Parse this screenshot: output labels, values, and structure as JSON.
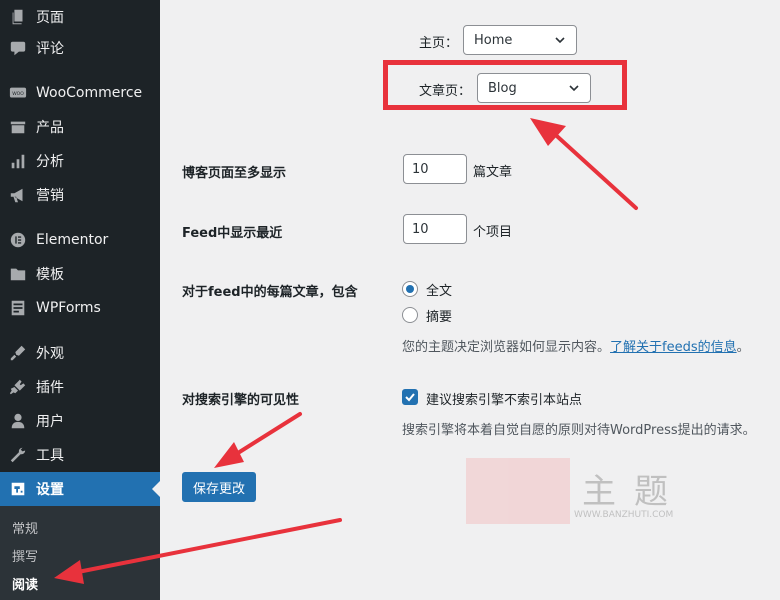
{
  "sidebar": {
    "items": [
      {
        "label": "页面",
        "icon": "pages-icon"
      },
      {
        "label": "评论",
        "icon": "comments-icon"
      },
      {
        "label": "WooCommerce",
        "icon": "woocommerce-icon"
      },
      {
        "label": "产品",
        "icon": "products-icon"
      },
      {
        "label": "分析",
        "icon": "analytics-icon"
      },
      {
        "label": "营销",
        "icon": "marketing-icon"
      },
      {
        "label": "Elementor",
        "icon": "elementor-icon"
      },
      {
        "label": "模板",
        "icon": "templates-icon"
      },
      {
        "label": "WPForms",
        "icon": "wpforms-icon"
      },
      {
        "label": "外观",
        "icon": "appearance-icon"
      },
      {
        "label": "插件",
        "icon": "plugins-icon"
      },
      {
        "label": "用户",
        "icon": "users-icon"
      },
      {
        "label": "工具",
        "icon": "tools-icon"
      },
      {
        "label": "设置",
        "icon": "settings-icon",
        "active": true
      }
    ],
    "submenu": [
      {
        "label": "常规"
      },
      {
        "label": "撰写"
      },
      {
        "label": "阅读",
        "current": true
      }
    ]
  },
  "reading": {
    "homepage_label": "主页：",
    "homepage_value": "Home",
    "posts_page_label": "文章页：",
    "posts_page_value": "Blog",
    "blog_pages_label": "博客页面至多显示",
    "blog_pages_value": "10",
    "blog_pages_unit": "篇文章",
    "feed_label": "Feed中显示最近",
    "feed_value": "10",
    "feed_unit": "个项目",
    "feed_content_label": "对于feed中的每篇文章，包含",
    "option_full": "全文",
    "option_excerpt": "摘要",
    "selected_option": "全文",
    "feed_desc_prefix": "您的主题决定浏览器如何显示内容。",
    "feed_desc_link": "了解关于feeds的信息",
    "feed_desc_suffix": "。",
    "search_visibility_label": "对搜索引擎的可见性",
    "search_checkbox_label": "建议搜索引擎不索引本站点",
    "search_checkbox_checked": true,
    "search_desc": "搜索引擎将本着自觉自愿的原则对待WordPress提出的请求。"
  },
  "actions": {
    "save_label": "保存更改"
  },
  "watermark": {
    "main": "主题",
    "url": "WWW.BANZHUTI.COM"
  },
  "colors": {
    "sidebar_bg": "#1d2327",
    "active_bg": "#2271b1",
    "annotation_red": "#e8323c"
  }
}
